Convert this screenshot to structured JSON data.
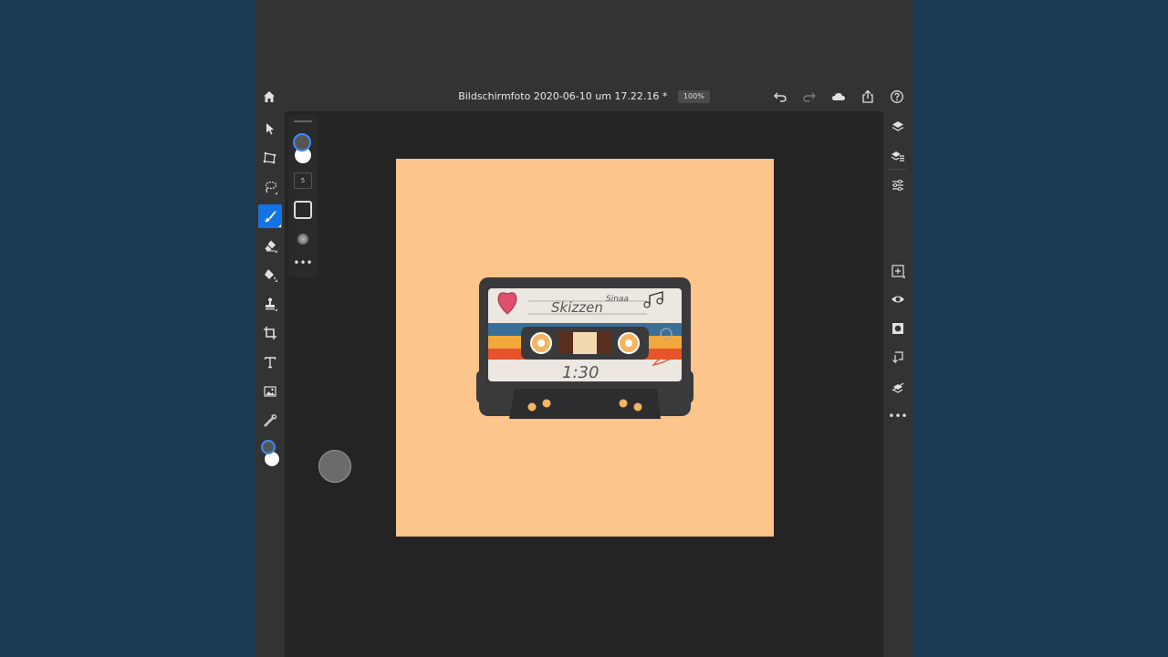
{
  "document": {
    "title": "Bildschirmfoto 2020-06-10 um 17.22.16 *",
    "zoom": "100%",
    "background_color": "#fbc58c"
  },
  "header": {
    "icons": [
      "home-icon",
      "undo-icon",
      "redo-icon",
      "cloud-icon",
      "share-icon",
      "help-icon"
    ]
  },
  "toolbar": {
    "tools": [
      "select-tool",
      "transform-tool",
      "lasso-tool",
      "brush-tool",
      "eraser-tool",
      "fill-tool",
      "clone-stamp-tool",
      "crop-tool",
      "type-tool",
      "place-image-tool",
      "eyedropper-tool"
    ],
    "active_tool": "brush-tool",
    "foreground_color": "#555555",
    "background_color": "#ffffff"
  },
  "brush_flyout": {
    "size_label": "5"
  },
  "right_panel": {
    "icons": [
      "layers-icon",
      "layer-properties-icon",
      "adjustments-icon",
      "add-layer-icon",
      "visibility-icon",
      "mask-icon",
      "clipping-icon",
      "lock-icon",
      "more-icon"
    ]
  },
  "cassette": {
    "label_text": "Skizzen",
    "label_signature": "Sinaa",
    "time_text": "1:30",
    "body_color": "#3a3a3c",
    "stripe_colors": [
      "#3a6f9a",
      "#f2a93b",
      "#e8532b"
    ],
    "label_color": "#ece8e1",
    "accent_color": "#f5b562"
  }
}
